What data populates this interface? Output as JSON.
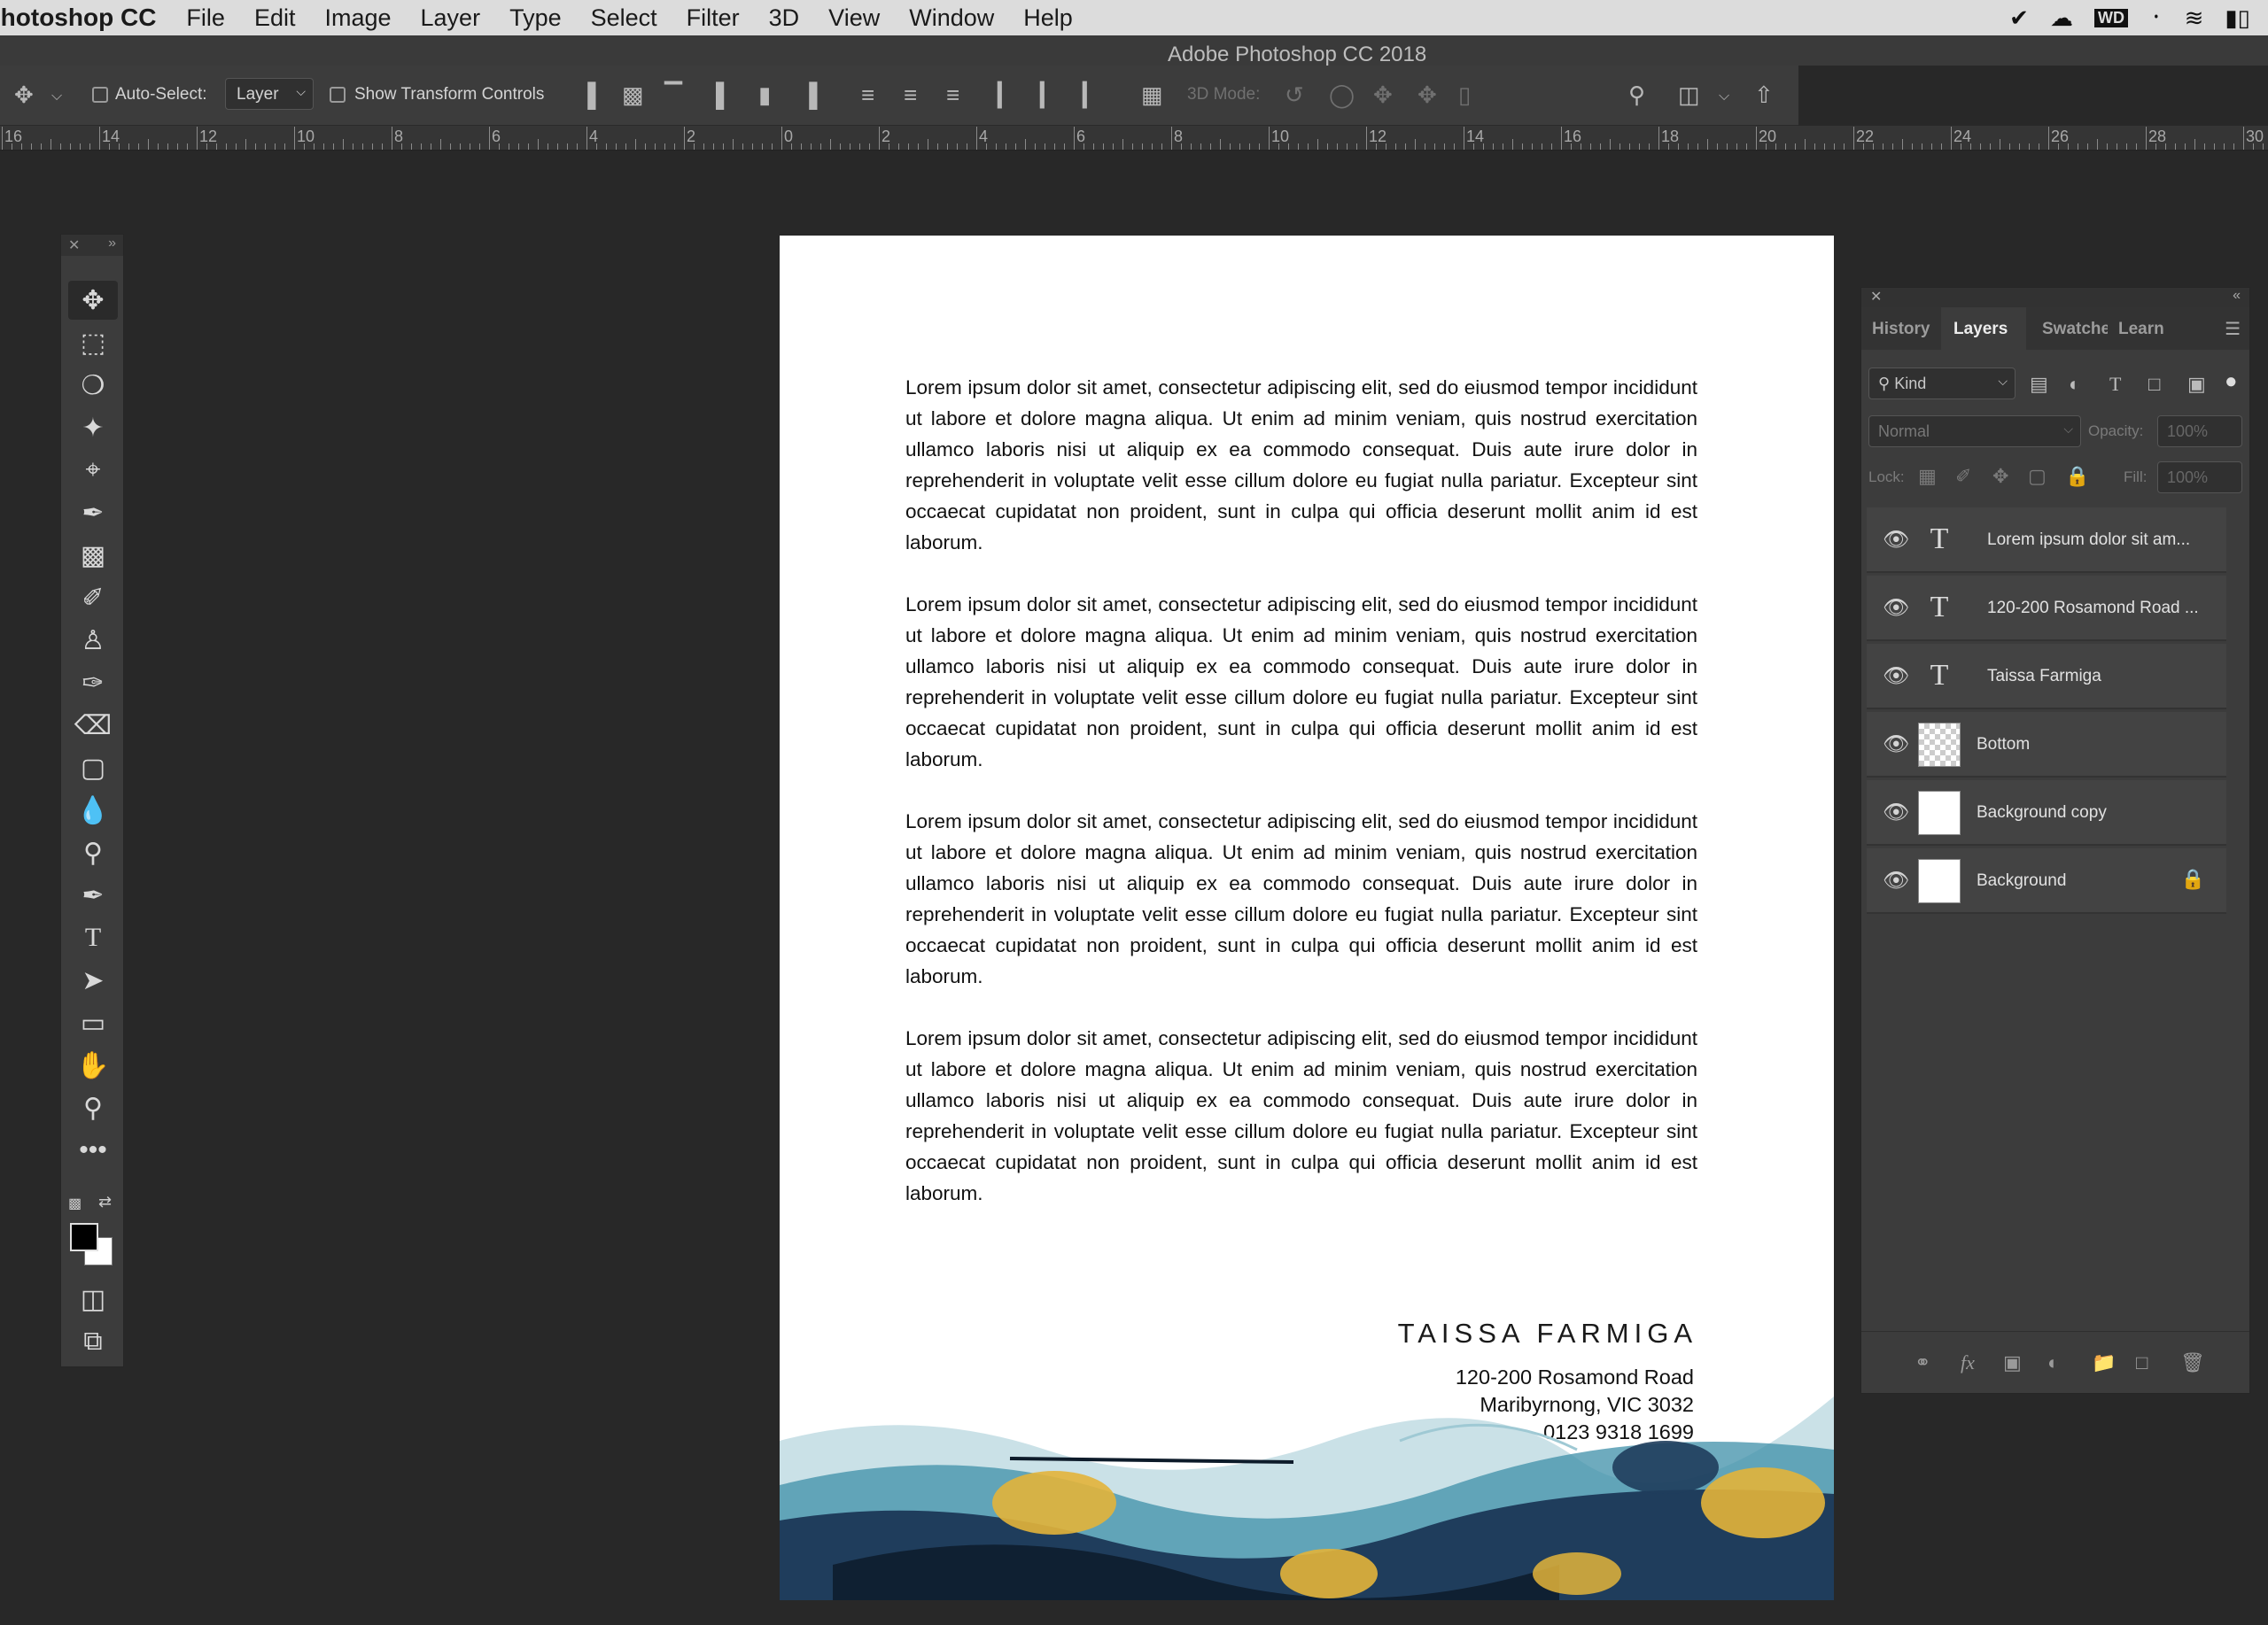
{
  "menubar": {
    "app_name": "Photoshop CC",
    "items": [
      "File",
      "Edit",
      "Image",
      "Layer",
      "Type",
      "Select",
      "Filter",
      "3D",
      "View",
      "Window",
      "Help"
    ],
    "status_icons": [
      "checkmark-icon",
      "creative-cloud-icon",
      "wd-icon",
      "bluetooth-icon",
      "wifi-icon",
      "battery-icon"
    ],
    "wd_label": "WD"
  },
  "window": {
    "title": "Adobe Photoshop CC 2018"
  },
  "options_bar": {
    "auto_select_label": "Auto-Select:",
    "auto_select_value": "Layer",
    "show_transform_label": "Show Transform Controls",
    "mode_3d_label": "3D Mode:"
  },
  "ruler": {
    "labels": [
      "16",
      "14",
      "12",
      "10",
      "8",
      "6",
      "4",
      "2",
      "0",
      "2",
      "4",
      "6",
      "8",
      "10",
      "12",
      "14",
      "16",
      "18",
      "20",
      "22",
      "24",
      "26",
      "28",
      "30"
    ]
  },
  "tools": [
    "move",
    "marquee",
    "lasso",
    "magic-wand",
    "crop",
    "eyedropper",
    "healing",
    "brush",
    "stamp",
    "history-brush",
    "eraser",
    "gradient",
    "blur",
    "dodge",
    "pen",
    "type",
    "path-select",
    "rectangle",
    "hand",
    "zoom",
    "more"
  ],
  "document": {
    "paragraphs": [
      "Lorem ipsum dolor sit amet, consectetur adipiscing elit, sed do eiusmod tempor incididunt ut labore et dolore magna aliqua. Ut enim ad minim veniam, quis nostrud exercitation ullamco laboris nisi ut aliquip ex ea commodo consequat. Duis aute irure dolor in reprehenderit in voluptate velit esse cillum dolore eu fugiat nulla pariatur. Excepteur sint occaecat cupidatat non proident, sunt in culpa qui officia deserunt mollit anim id est laborum.",
      "Lorem ipsum dolor sit amet, consectetur adipiscing elit, sed do eiusmod tempor incididunt ut labore et dolore magna aliqua. Ut enim ad minim veniam, quis nostrud exercitation ullamco laboris nisi ut aliquip ex ea commodo consequat. Duis aute irure dolor in reprehenderit in voluptate velit esse cillum dolore eu fugiat nulla pariatur. Excepteur sint occaecat cupidatat non proident, sunt in culpa qui officia deserunt mollit anim id est laborum.",
      "Lorem ipsum dolor sit amet, consectetur adipiscing elit, sed do eiusmod tempor incididunt ut labore et dolore magna aliqua. Ut enim ad minim veniam, quis nostrud exercitation ullamco laboris nisi ut aliquip ex ea commodo consequat. Duis aute irure dolor in reprehenderit in voluptate velit esse cillum dolore eu fugiat nulla pariatur. Excepteur sint occaecat cupidatat non proident, sunt in culpa qui officia deserunt mollit anim id est laborum.",
      "Lorem ipsum dolor sit amet, consectetur adipiscing elit, sed do eiusmod tempor incididunt ut labore et dolore magna aliqua. Ut enim ad minim veniam, quis nostrud exercitation ullamco laboris nisi ut aliquip ex ea commodo consequat. Duis aute irure dolor in reprehenderit in voluptate velit esse cillum dolore eu fugiat nulla pariatur. Excepteur sint occaecat cupidatat non proident, sunt in culpa qui officia deserunt mollit anim id est laborum."
    ],
    "name": "TAISSA FARMIGA",
    "address_line1": "120-200 Rosamond Road",
    "address_line2": "Maribyrnong, VIC 3032",
    "phone": "0123 9318 1699",
    "art_colors": [
      "#1f3d5c",
      "#3e8fa8",
      "#e3b43a",
      "#0d1b2a",
      "#9fc9d4"
    ]
  },
  "layers_panel": {
    "tabs": [
      "History",
      "Layers",
      "Swatche",
      "Learn"
    ],
    "active_tab": "Layers",
    "filter_label": "Kind",
    "blend_mode": "Normal",
    "opacity_label": "Opacity:",
    "opacity_value": "100%",
    "lock_label": "Lock:",
    "fill_label": "Fill:",
    "fill_value": "100%",
    "layers": [
      {
        "name": "Lorem ipsum dolor sit am...",
        "kind": "text"
      },
      {
        "name": "120-200 Rosamond Road ...",
        "kind": "text"
      },
      {
        "name": "Taissa Farmiga",
        "kind": "text"
      },
      {
        "name": "Bottom",
        "kind": "transparent"
      },
      {
        "name": "Background copy",
        "kind": "image"
      },
      {
        "name": "Background",
        "kind": "image",
        "locked": true
      }
    ]
  }
}
